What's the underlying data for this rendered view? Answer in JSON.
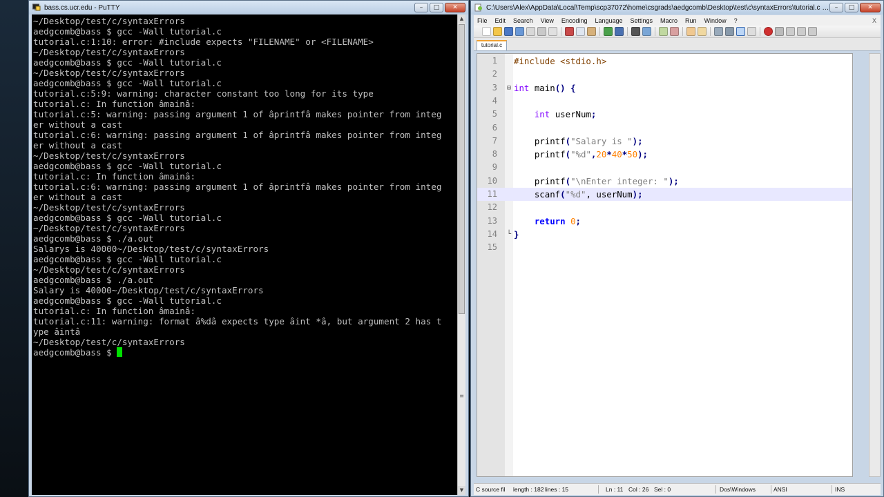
{
  "putty": {
    "title": "bass.cs.ucr.edu - PuTTY",
    "lines": [
      "~/Desktop/test/c/syntaxErrors",
      "aedgcomb@bass $ gcc -Wall tutorial.c",
      "tutorial.c:1:10: error: #include expects \"FILENAME\" or <FILENAME>",
      "~/Desktop/test/c/syntaxErrors",
      "aedgcomb@bass $ gcc -Wall tutorial.c",
      "~/Desktop/test/c/syntaxErrors",
      "aedgcomb@bass $ gcc -Wall tutorial.c",
      "tutorial.c:5:9: warning: character constant too long for its type",
      "tutorial.c: In function âmainâ:",
      "tutorial.c:5: warning: passing argument 1 of âprintfâ makes pointer from integ",
      "er without a cast",
      "tutorial.c:6: warning: passing argument 1 of âprintfâ makes pointer from integ",
      "er without a cast",
      "~/Desktop/test/c/syntaxErrors",
      "aedgcomb@bass $ gcc -Wall tutorial.c",
      "tutorial.c: In function âmainâ:",
      "tutorial.c:6: warning: passing argument 1 of âprintfâ makes pointer from integ",
      "er without a cast",
      "~/Desktop/test/c/syntaxErrors",
      "aedgcomb@bass $ gcc -Wall tutorial.c",
      "~/Desktop/test/c/syntaxErrors",
      "aedgcomb@bass $ ./a.out",
      "Salarys is 40000~/Desktop/test/c/syntaxErrors",
      "aedgcomb@bass $ gcc -Wall tutorial.c",
      "~/Desktop/test/c/syntaxErrors",
      "aedgcomb@bass $ ./a.out",
      "Salary is 40000~/Desktop/test/c/syntaxErrors",
      "aedgcomb@bass $ gcc -Wall tutorial.c",
      "tutorial.c: In function âmainâ:",
      "tutorial.c:11: warning: format â%dâ expects type âint *â, but argument 2 has t",
      "ype âintâ",
      "~/Desktop/test/c/syntaxErrors"
    ],
    "prompt": "aedgcomb@bass $ "
  },
  "npp": {
    "title": "C:\\Users\\Alex\\AppData\\Local\\Temp\\scp37072\\home\\csgrads\\aedgcomb\\Desktop\\test\\c\\syntaxErrors\\tutorial.c - Notep...",
    "menu": [
      "File",
      "Edit",
      "Search",
      "View",
      "Encoding",
      "Language",
      "Settings",
      "Macro",
      "Run",
      "Window",
      "?"
    ],
    "menu_close": "X",
    "tab": "tutorial.c",
    "line_numbers": [
      "1",
      "2",
      "3",
      "4",
      "5",
      "6",
      "7",
      "8",
      "9",
      "10",
      "11",
      "12",
      "13",
      "14",
      "15"
    ],
    "status": {
      "type": "C source fil",
      "length": "length : 182",
      "lines": "lines : 15",
      "ln": "Ln : 11",
      "col": "Col : 26",
      "sel": "Sel : 0",
      "eol": "Dos\\Windows",
      "encoding": "ANSI",
      "mode": "INS"
    }
  },
  "code_tokens": {
    "l1": [
      "#include <stdio.h>"
    ],
    "l3": [
      "int",
      " main",
      "()",
      " {"
    ],
    "l5": [
      "int",
      " userNum",
      ";"
    ],
    "l7": [
      "printf",
      "(",
      "\"Salary is \"",
      ");"
    ],
    "l8": [
      "printf",
      "(",
      "\"%d\"",
      ",",
      "20",
      "*",
      "40",
      "*",
      "50",
      ");"
    ],
    "l10": [
      "printf",
      "(",
      "\"\\nEnter integer: \"",
      ");"
    ],
    "l11": [
      "scanf",
      "(",
      "\"%d\"",
      ", userNum",
      ");"
    ],
    "l13": [
      "return",
      " ",
      "0",
      ";"
    ],
    "l14": [
      "}"
    ]
  },
  "colors": {
    "term_bg": "#000000",
    "term_fg": "#c0c0c0",
    "cursor": "#00e000",
    "keyword": "#0000ff",
    "string": "#808080",
    "number": "#ff8000"
  }
}
